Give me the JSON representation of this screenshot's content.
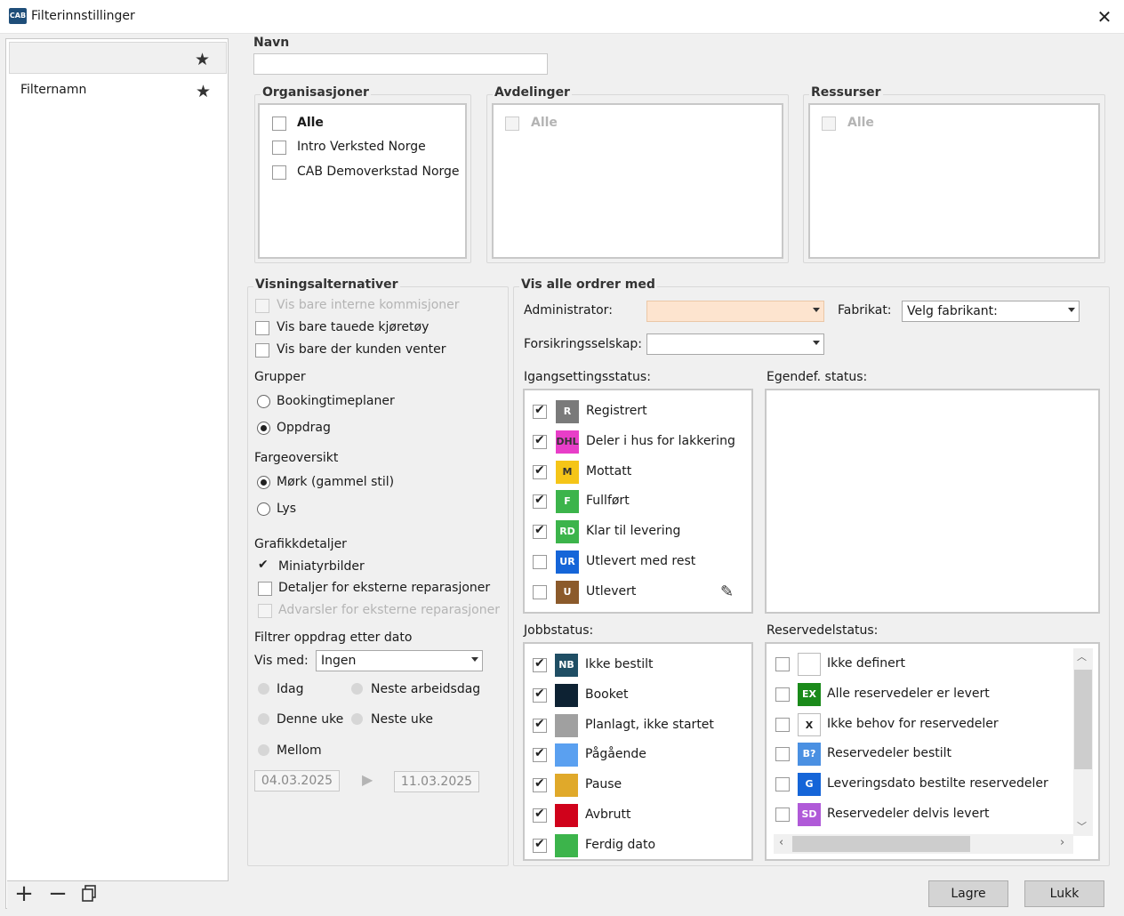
{
  "window": {
    "title": "Filterinnstillinger",
    "app_icon": "CAB"
  },
  "left_panel": {
    "items": [
      {
        "label": "",
        "starred": true
      },
      {
        "label": "Filternamn",
        "starred": true
      }
    ]
  },
  "name_field": {
    "label": "Navn",
    "value": ""
  },
  "organisasjoner": {
    "title": "Organisasjoner",
    "items": [
      {
        "label": "Alle",
        "bold": true
      },
      {
        "label": "Intro Verksted Norge"
      },
      {
        "label": "CAB Demoverkstad Norge"
      }
    ]
  },
  "avdelinger": {
    "title": "Avdelinger",
    "all_label": "Alle"
  },
  "ressurser": {
    "title": "Ressurser",
    "all_label": "Alle"
  },
  "visning": {
    "title": "Visningsalternativer",
    "opt_interne": "Vis bare interne kommisjoner",
    "opt_tauede": "Vis bare tauede kjøretøy",
    "opt_venter": "Vis bare der kunden venter",
    "grupper_label": "Grupper",
    "grupper_booking": "Bookingtimeplaner",
    "grupper_oppdrag": "Oppdrag",
    "farge_label": "Fargeoversikt",
    "farge_mork": "Mørk (gammel stil)",
    "farge_lys": "Lys",
    "grafikk_label": "Grafikkdetaljer",
    "grafikk_mini": "Miniatyrbilder",
    "grafikk_detaljer": "Detaljer for eksterne reparasjoner",
    "grafikk_advarsler": "Advarsler for eksterne reparasjoner",
    "filtrer_label": "Filtrer oppdrag etter dato",
    "vis_med_label": "Vis med:",
    "vis_med_value": "Ingen",
    "idag": "Idag",
    "neste_arbeidsdag": "Neste arbeidsdag",
    "denne_uke": "Denne uke",
    "neste_uke": "Neste uke",
    "mellom": "Mellom",
    "date_from": "04.03.2025",
    "date_to": "11.03.2025"
  },
  "vis_alle": {
    "title": "Vis alle ordrer med",
    "administrator_label": "Administrator:",
    "administrator_value": "",
    "fabrikat_label": "Fabrikat:",
    "fabrikat_value": "Velg fabrikant:",
    "forsikring_label": "Forsikringsselskap:",
    "forsikring_value": "",
    "igang_label": "Igangsettingsstatus:",
    "egendef_label": "Egendef. status:",
    "jobb_label": "Jobbstatus:",
    "reserve_label": "Reservedelstatus:"
  },
  "igang_status": [
    {
      "code": "R",
      "label": "Registrert",
      "color": "#7a7a7a",
      "checked": true
    },
    {
      "code": "DHL",
      "label": "Deler i hus for lakkering",
      "color": "#e83ec8",
      "checked": true
    },
    {
      "code": "M",
      "label": "Mottatt",
      "color": "#f5c518",
      "checked": true
    },
    {
      "code": "F",
      "label": "Fullført",
      "color": "#3cb44b",
      "checked": true
    },
    {
      "code": "RD",
      "label": "Klar til levering",
      "color": "#3cb44b",
      "checked": true
    },
    {
      "code": "UR",
      "label": "Utlevert med rest",
      "color": "#1565d8",
      "checked": false
    },
    {
      "code": "U",
      "label": "Utlevert",
      "color": "#8b5a2b",
      "checked": false
    }
  ],
  "jobb_status": [
    {
      "code": "NB",
      "label": "Ikke bestilt",
      "color": "#1f4e64",
      "checked": true
    },
    {
      "code": "",
      "label": "Booket",
      "color": "#0d2233",
      "checked": true
    },
    {
      "code": "",
      "label": "Planlagt, ikke startet",
      "color": "#a0a0a0",
      "checked": true
    },
    {
      "code": "",
      "label": "Pågående",
      "color": "#5aa0f0",
      "checked": true
    },
    {
      "code": "",
      "label": "Pause",
      "color": "#e0a92a",
      "checked": true
    },
    {
      "code": "",
      "label": "Avbrutt",
      "color": "#d0021b",
      "checked": true
    },
    {
      "code": "",
      "label": "Ferdig dato",
      "color": "#3cb44b",
      "checked": true
    }
  ],
  "reserve_status": [
    {
      "code": "",
      "label": "Ikke definert",
      "color": "#ffffff",
      "checked": false
    },
    {
      "code": "EX",
      "label": "Alle reservedeler er levert",
      "color": "#1a8a1a",
      "checked": false
    },
    {
      "code": "X",
      "label": "Ikke behov for reservedeler",
      "color": "#ffffff",
      "checked": false
    },
    {
      "code": "B?",
      "label": "Reservedeler bestilt",
      "color": "#4a90e2",
      "checked": false
    },
    {
      "code": "G",
      "label": "Leveringsdato bestilte reservedeler",
      "color": "#1565d8",
      "checked": false
    },
    {
      "code": "SD",
      "label": "Reservedeler delvis levert",
      "color": "#b05ad8",
      "checked": false
    }
  ],
  "buttons": {
    "save": "Lagre",
    "close": "Lukk"
  }
}
